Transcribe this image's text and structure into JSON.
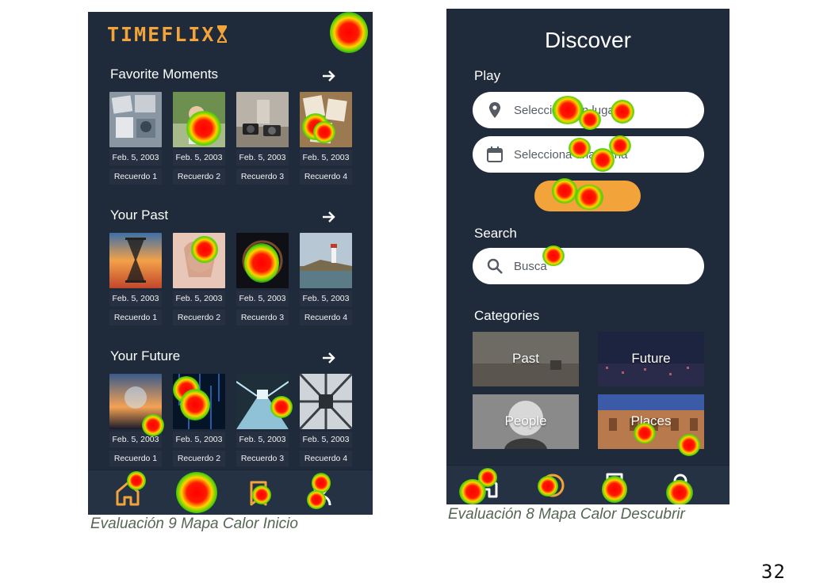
{
  "left_screen": {
    "logo": "TIMEFLIX",
    "sections": [
      {
        "title": "Favorite Moments",
        "tiles": [
          {
            "date": "Feb. 5, 2003",
            "name": "Recuerdo 1",
            "image": "photos-collage"
          },
          {
            "date": "Feb. 5, 2003",
            "name": "Recuerdo 2",
            "image": "outdoor-friends"
          },
          {
            "date": "Feb. 5, 2003",
            "name": "Recuerdo 3",
            "image": "cameras-table"
          },
          {
            "date": "Feb. 5, 2003",
            "name": "Recuerdo 4",
            "image": "polaroid-photos"
          }
        ]
      },
      {
        "title": "Your Past",
        "tiles": [
          {
            "date": "Feb. 5, 2003",
            "name": "Recuerdo 1",
            "image": "hourglass-sunset"
          },
          {
            "date": "Feb. 5, 2003",
            "name": "Recuerdo 2",
            "image": "woman-thinking"
          },
          {
            "date": "Feb. 5, 2003",
            "name": "Recuerdo 3",
            "image": "space-swirl"
          },
          {
            "date": "Feb. 5, 2003",
            "name": "Recuerdo 4",
            "image": "lighthouse-coast"
          }
        ]
      },
      {
        "title": "Your Future",
        "tiles": [
          {
            "date": "Feb. 5, 2003",
            "name": "Recuerdo 1",
            "image": "crystal-ball-sunset"
          },
          {
            "date": "Feb. 5, 2003",
            "name": "Recuerdo 2",
            "image": "digital-rain"
          },
          {
            "date": "Feb. 5, 2003",
            "name": "Recuerdo 3",
            "image": "futuristic-tunnel"
          },
          {
            "date": "Feb. 5, 2003",
            "name": "Recuerdo 4",
            "image": "mirror-architecture"
          }
        ]
      }
    ],
    "nav": [
      "home-icon",
      "discover-icon",
      "bookmark-icon",
      "profile-icon"
    ],
    "caption": "Evaluación 9 Mapa Calor Inicio"
  },
  "right_screen": {
    "title": "Discover",
    "play_label": "Play",
    "place_placeholder": "Selecciona un lugar",
    "date_placeholder": "Selecciona una fecha",
    "search_label": "Search",
    "search_placeholder": "Busca",
    "categories_label": "Categories",
    "categories": [
      "Past",
      "Future",
      "People",
      "Places"
    ],
    "nav": [
      "home-icon",
      "discover-icon",
      "bookmark-icon",
      "profile-icon"
    ],
    "caption": "Evaluación 8 Mapa Calor Descubrir"
  },
  "page_number": "32",
  "colors": {
    "screen_bg": "#1f2a3a",
    "accent": "#f2a33a",
    "caption": "#556655"
  }
}
